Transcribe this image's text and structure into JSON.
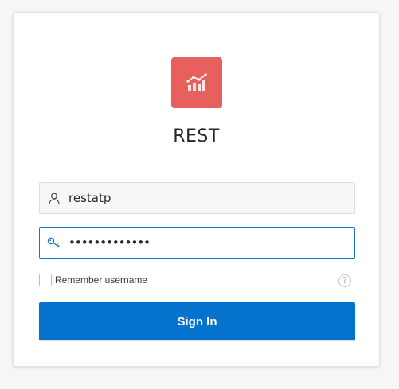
{
  "app": {
    "title": "REST",
    "icon": "bar-chart-trend-icon",
    "icon_color": "#e8605e"
  },
  "login": {
    "username_value": "restatp",
    "username_icon": "user-icon",
    "password_masked": "•••••••••••••",
    "password_icon": "key-icon",
    "remember_label": "Remember username",
    "remember_checked": false,
    "help_icon": "help-icon",
    "help_glyph": "?",
    "signin_label": "Sign In",
    "accent_color": "#0572ce"
  }
}
